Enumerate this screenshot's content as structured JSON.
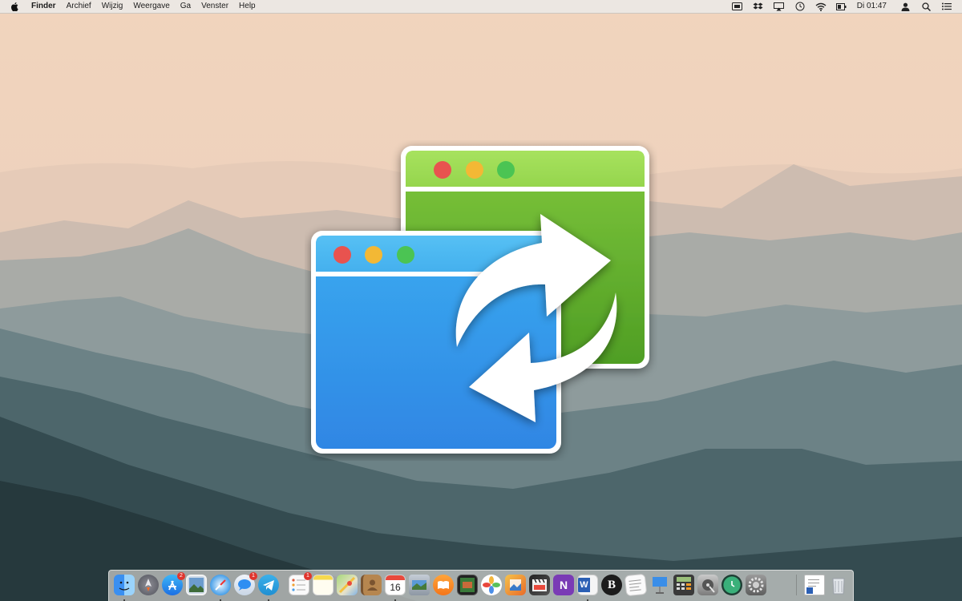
{
  "menubar": {
    "app_name": "Finder",
    "menus": [
      "Archief",
      "Wijzig",
      "Weergave",
      "Ga",
      "Venster",
      "Help"
    ],
    "clock": "Di 01:47",
    "status_icons": [
      "screen-share-icon",
      "dropbox-icon",
      "airplay-icon",
      "time-machine-icon",
      "wifi-icon",
      "battery-icon",
      "user-icon",
      "spotlight-search-icon",
      "notification-center-icon"
    ]
  },
  "app_icon": {
    "name": "window-sync-app-icon",
    "colors": {
      "green_window": "#6cc23a",
      "blue_window": "#3aa2ec",
      "close": "#e8534f",
      "minimize": "#f3b834",
      "zoom": "#4cc452",
      "arrows": "#ffffff"
    }
  },
  "dock": {
    "items": [
      {
        "name": "finder",
        "icon": "finder-icon",
        "running": true,
        "badge": ""
      },
      {
        "name": "launchpad",
        "icon": "launchpad-icon",
        "running": false,
        "badge": ""
      },
      {
        "name": "app-store",
        "icon": "app-store-icon",
        "running": false,
        "badge": "2"
      },
      {
        "name": "preview",
        "icon": "preview-icon",
        "running": false,
        "badge": ""
      },
      {
        "name": "safari",
        "icon": "safari-icon",
        "running": true,
        "badge": ""
      },
      {
        "name": "messages",
        "icon": "messages-icon",
        "running": false,
        "badge": "1"
      },
      {
        "name": "telegram",
        "icon": "telegram-icon",
        "running": true,
        "badge": ""
      },
      {
        "name": "reminders",
        "icon": "reminders-icon",
        "running": false,
        "badge": "1"
      },
      {
        "name": "notes",
        "icon": "notes-icon",
        "running": false,
        "badge": ""
      },
      {
        "name": "maps",
        "icon": "maps-icon",
        "running": false,
        "badge": ""
      },
      {
        "name": "contacts",
        "icon": "contacts-icon",
        "running": false,
        "badge": ""
      },
      {
        "name": "calendar",
        "icon": "calendar-icon",
        "running": true,
        "badge": "",
        "label": "16"
      },
      {
        "name": "image-capture",
        "icon": "image-capture-icon",
        "running": false,
        "badge": ""
      },
      {
        "name": "ibooks",
        "icon": "ibooks-icon",
        "running": false,
        "badge": ""
      },
      {
        "name": "photo-booth",
        "icon": "photo-booth-icon",
        "running": false,
        "badge": ""
      },
      {
        "name": "photos",
        "icon": "photos-icon",
        "running": false,
        "badge": ""
      },
      {
        "name": "preview-alt",
        "icon": "image-viewer-icon",
        "running": false,
        "badge": ""
      },
      {
        "name": "final-cut-pro",
        "icon": "clapper-icon",
        "running": false,
        "badge": ""
      },
      {
        "name": "onenote",
        "icon": "onenote-icon",
        "running": false,
        "badge": ""
      },
      {
        "name": "word",
        "icon": "word-icon",
        "running": true,
        "badge": ""
      },
      {
        "name": "bbedit",
        "icon": "bbedit-icon",
        "running": false,
        "badge": "",
        "label": "B"
      },
      {
        "name": "textedit",
        "icon": "textedit-icon",
        "running": false,
        "badge": ""
      },
      {
        "name": "keynote",
        "icon": "keynote-icon",
        "running": false,
        "badge": ""
      },
      {
        "name": "calculator",
        "icon": "calculator-icon",
        "running": false,
        "badge": ""
      },
      {
        "name": "disk-utility",
        "icon": "disk-utility-icon",
        "running": false,
        "badge": ""
      },
      {
        "name": "time-machine",
        "icon": "time-machine-icon",
        "running": false,
        "badge": ""
      },
      {
        "name": "system-preferences",
        "icon": "gear-icon",
        "running": false,
        "badge": ""
      },
      {
        "name": "documents",
        "icon": "word-document-icon",
        "running": false,
        "badge": ""
      },
      {
        "name": "trash",
        "icon": "trash-icon",
        "running": false,
        "badge": ""
      }
    ]
  }
}
